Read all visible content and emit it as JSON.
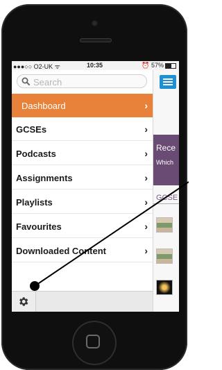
{
  "status": {
    "carrier": "●●●○○ O2-UK ᯤ",
    "time": "10:35",
    "battery": "57%"
  },
  "search": {
    "placeholder": "Search"
  },
  "menu": {
    "items": [
      {
        "label": "Dashboard",
        "active": true
      },
      {
        "label": "GCSEs",
        "active": false
      },
      {
        "label": "Podcasts",
        "active": false
      },
      {
        "label": "Assignments",
        "active": false
      },
      {
        "label": "Playlists",
        "active": false
      },
      {
        "label": "Favourites",
        "active": false
      },
      {
        "label": "Downloaded Content",
        "active": false
      }
    ],
    "chevron": "›"
  },
  "peek": {
    "banner_title": "Rece",
    "banner_sub": "Which",
    "section_label": "GCSE"
  },
  "colors": {
    "active_item": "#e8823a",
    "menu_button": "#1e90d6",
    "banner": "#6a4b74"
  },
  "icons": {
    "search": "search-icon",
    "settings": "gear-icon",
    "menu": "hamburger-icon"
  }
}
